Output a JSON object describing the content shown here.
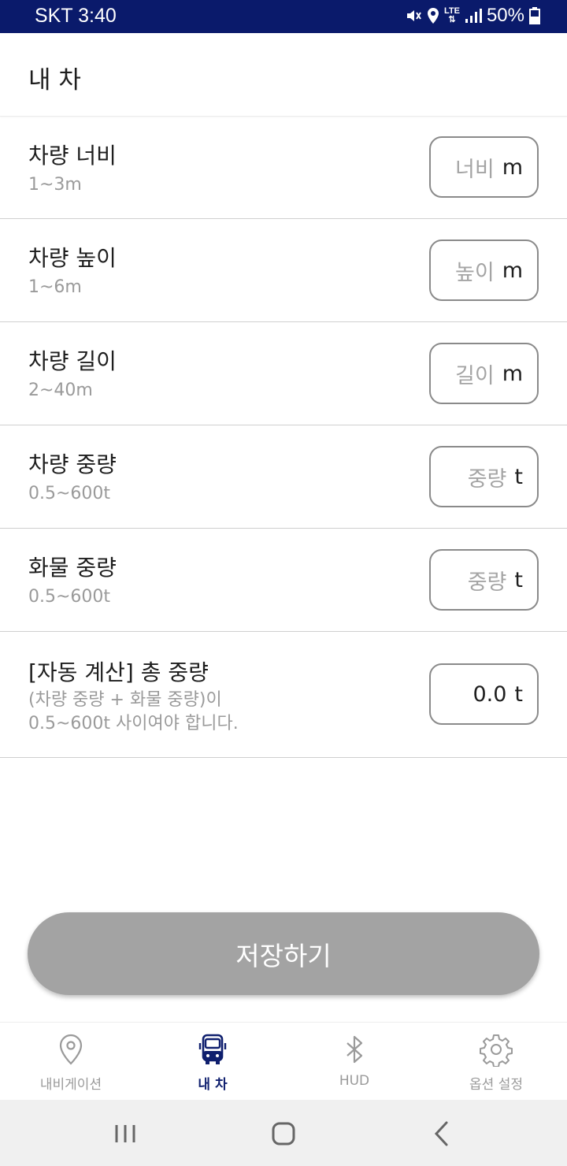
{
  "status_bar": {
    "carrier_time": "SKT 3:40",
    "network": "LTE",
    "battery": "50%"
  },
  "header": {
    "title": "내 차"
  },
  "settings": [
    {
      "label": "차량 너비",
      "hint": "1~3m",
      "placeholder": "너비",
      "unit": "m"
    },
    {
      "label": "차량 높이",
      "hint": "1~6m",
      "placeholder": "높이",
      "unit": "m"
    },
    {
      "label": "차량 길이",
      "hint": "2~40m",
      "placeholder": "길이",
      "unit": "m"
    },
    {
      "label": "차량 중량",
      "hint": "0.5~600t",
      "placeholder": "중량",
      "unit": "t"
    },
    {
      "label": "화물 중량",
      "hint": "0.5~600t",
      "placeholder": "중량",
      "unit": "t"
    }
  ],
  "total_weight": {
    "label": "[자동 계산] 총 중량",
    "hint_line1": "(차량 중량 + 화물 중량)이",
    "hint_line2": "0.5~600t 사이여야 합니다.",
    "value": "0.0",
    "unit": "t"
  },
  "save_button": {
    "label": "저장하기"
  },
  "bottom_nav": {
    "items": [
      {
        "label": "내비게이션",
        "icon": "location-pin-icon",
        "active": false
      },
      {
        "label": "내 차",
        "icon": "truck-icon",
        "active": true
      },
      {
        "label": "HUD",
        "icon": "bluetooth-icon",
        "active": false
      },
      {
        "label": "옵션 설정",
        "icon": "gear-icon",
        "active": false
      }
    ]
  },
  "colors": {
    "status_bar": "#0a1a6b",
    "active_nav": "#0f1f6e",
    "save_button_disabled": "#a3a3a3",
    "hint_text": "#9a9a9a"
  }
}
